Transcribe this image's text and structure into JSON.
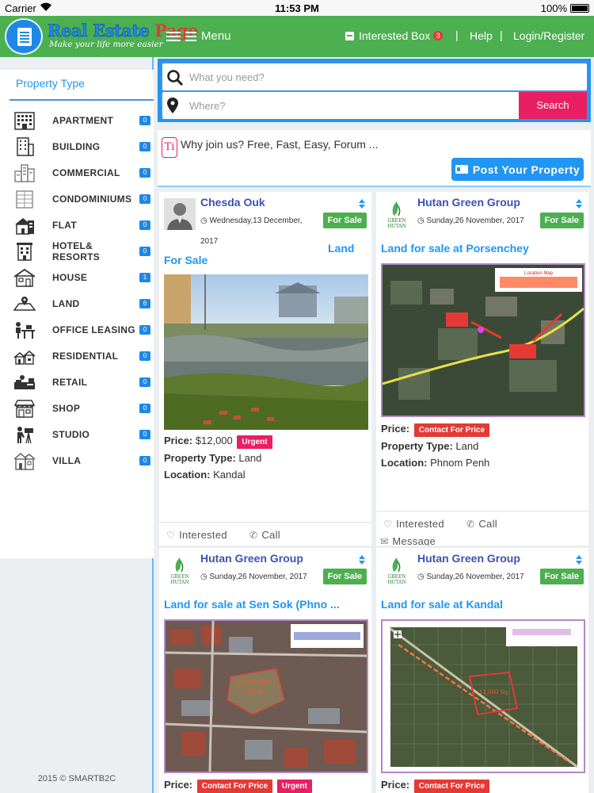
{
  "status_bar": {
    "carrier": "Carrier",
    "time": "11:53 PM",
    "battery": "100%"
  },
  "header": {
    "logo_title_a": "Real Estate",
    "logo_title_b": "Page",
    "logo_tagline": "Make your life more easier",
    "menu_label": "Menu",
    "interested_label": "Interested Box",
    "interested_count": "3",
    "separator": "|",
    "help_label": "Help",
    "login_label": "Login/Register"
  },
  "sidebar": {
    "title": "Property Type",
    "items": [
      {
        "label": "APARTMENT",
        "count": "0"
      },
      {
        "label": "BUILDING",
        "count": "0"
      },
      {
        "label": "COMMERCIAL",
        "count": "0"
      },
      {
        "label": "CONDOMINIUMS",
        "count": "0"
      },
      {
        "label": "FLAT",
        "count": "0"
      },
      {
        "label": "HOTEL& RESORTS",
        "count": "0"
      },
      {
        "label": "HOUSE",
        "count": "1"
      },
      {
        "label": "LAND",
        "count": "6"
      },
      {
        "label": "OFFICE LEASING",
        "count": "0"
      },
      {
        "label": "RESIDENTIAL",
        "count": "0"
      },
      {
        "label": "RETAIL",
        "count": "0"
      },
      {
        "label": "SHOP",
        "count": "0"
      },
      {
        "label": "STUDIO",
        "count": "0"
      },
      {
        "label": "VILLA",
        "count": "0"
      }
    ],
    "footer": "2015 © SMARTB2C"
  },
  "search": {
    "what_placeholder": "What you need?",
    "where_placeholder": "Where?",
    "button_label": "Search"
  },
  "join": {
    "logo_text": "Ti",
    "text": "Why join us? Free, Fast, Easy, Forum ...",
    "post_button": "Post Your Property"
  },
  "listings": [
    {
      "owner": "Chesda Ouk",
      "date_line1": "Wednesday,13 December,",
      "date_line2": "2017",
      "status": "For Sale",
      "title_a": "Land",
      "title_b": "For Sale",
      "price_label": "Price:",
      "price_value": "$12,000",
      "price_tag": "Urgent",
      "type_label": "Property Type:",
      "type_value": "Land",
      "location_label": "Location:",
      "location_value": "Kandal",
      "interested": "Interested",
      "call": "Call"
    },
    {
      "owner": "Hutan Green Group",
      "date_line1": "Sunday,26 November, 2017",
      "status": "For Sale",
      "title": "Land for sale at Porsenchey",
      "price_label": "Price:",
      "price_tag": "Contact For Price",
      "type_label": "Property Type:",
      "type_value": "Land",
      "location_label": "Location:",
      "location_value": "Phnom Penh",
      "interested": "Interested",
      "call": "Call",
      "message": "Message"
    },
    {
      "owner": "Hutan Green Group",
      "date_line1": "Sunday,26 November, 2017",
      "status": "For Sale",
      "title": "Land for sale at Sen Sok (Phno ...",
      "price_label": "Price:",
      "price_tag": "Contact For Price",
      "price_tag2": "Urgent"
    },
    {
      "owner": "Hutan Green Group",
      "date_line1": "Sunday,26 November, 2017",
      "status": "For Sale",
      "title": "Land for sale at Kandal",
      "price_label": "Price:",
      "price_tag": "Contact For Price"
    }
  ],
  "icons": {
    "wifi": "wifi-icon",
    "search": "search-icon",
    "location": "map-pin-icon",
    "heart": "heart-icon",
    "phone": "phone-icon",
    "envelope": "envelope-icon",
    "clock": "clock-icon"
  },
  "colors": {
    "header_green": "#4caf50",
    "link_blue": "#2196f3",
    "owner_indigo": "#3f51b5",
    "search_pink": "#e91e63",
    "tag_red": "#e53935"
  }
}
